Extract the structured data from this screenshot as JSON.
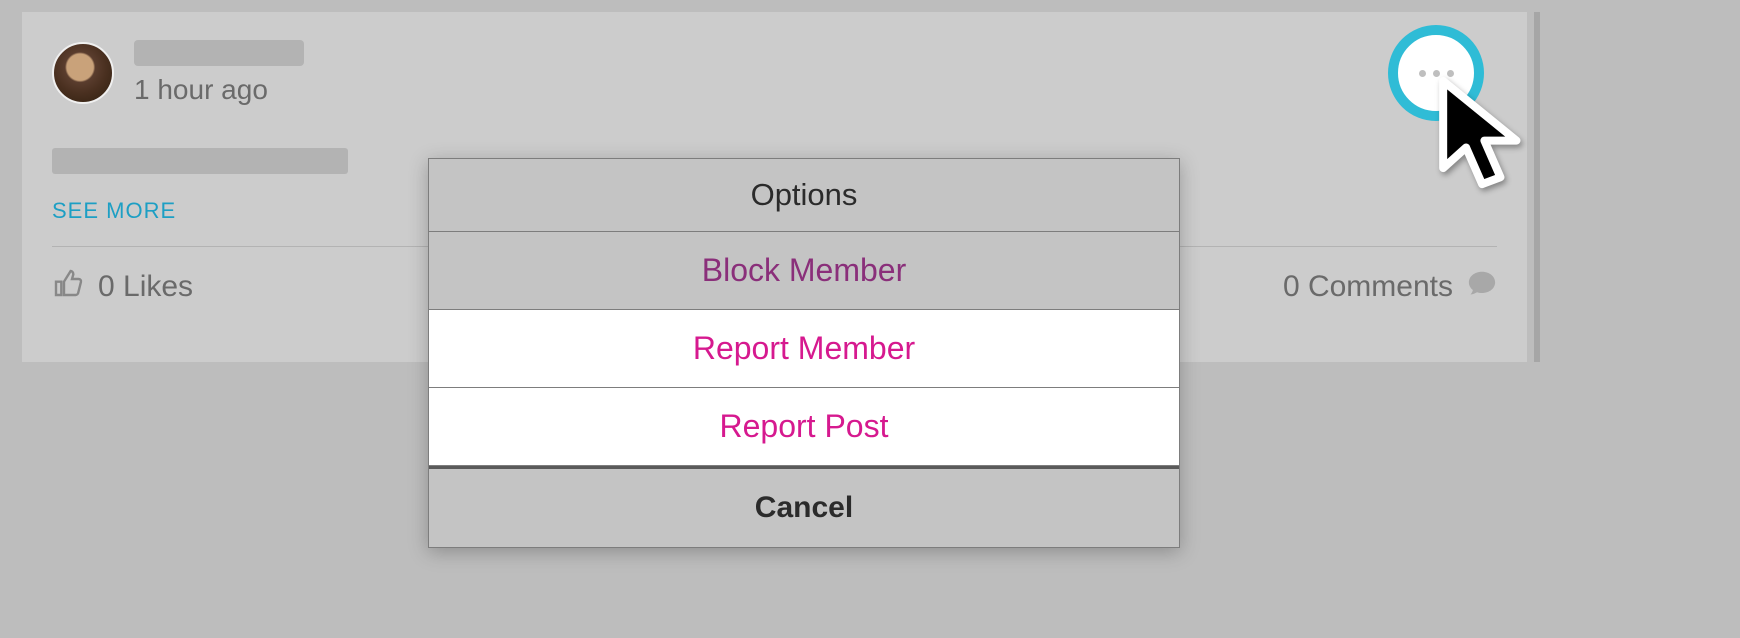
{
  "post": {
    "timestamp": "1 hour ago",
    "see_more_label": "SEE MORE",
    "likes_label": "0 Likes",
    "comments_label": "0 Comments"
  },
  "options_menu": {
    "title": "Options",
    "items": {
      "block_member": "Block Member",
      "report_member": "Report Member",
      "report_post": "Report Post"
    },
    "cancel_label": "Cancel"
  }
}
